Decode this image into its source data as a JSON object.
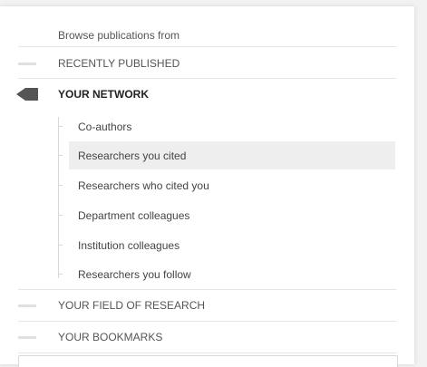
{
  "header": {
    "text": "Browse publications from"
  },
  "sections": {
    "recent": {
      "label": "RECENTLY PUBLISHED"
    },
    "network": {
      "label": "YOUR NETWORK",
      "items": [
        {
          "label": "Co-authors"
        },
        {
          "label": "Researchers you cited"
        },
        {
          "label": "Researchers who cited you"
        },
        {
          "label": "Department colleagues"
        },
        {
          "label": "Institution colleagues"
        },
        {
          "label": "Researchers you follow"
        }
      ],
      "highlighted_item": "Researchers you cited"
    },
    "field": {
      "label": "YOUR FIELD OF RESEARCH"
    },
    "bookmarks": {
      "label": "YOUR BOOKMARKS"
    }
  },
  "icons": {
    "collapsed": "dash-icon",
    "expanded": "pointer-arrow-icon"
  },
  "colors": {
    "active_marker": "#555555",
    "highlight_bg": "#eeeeee"
  }
}
